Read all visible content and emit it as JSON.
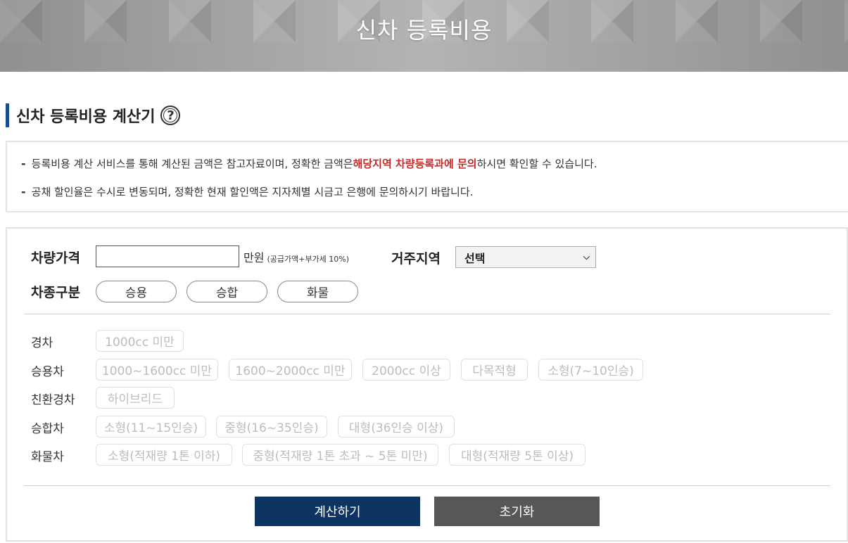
{
  "banner": {
    "title": "신차 등록비용"
  },
  "section": {
    "title": "신차 등록비용 계산기",
    "help_glyph": "?"
  },
  "notice": {
    "dash": "-",
    "line1_before": "등록비용 계산 서비스를 통해 계산된 금액은 참고자료이며, 정확한 금액은 ",
    "line1_highlight": "해당지역 차량등록과에 문의",
    "line1_after": "하시면 확인할 수 있습니다.",
    "line2": "공채 할인율은 수시로 변동되며, 정확한 현재 할인액은 지자체별 시금고 은행에 문의하시기 바랍니다.",
    "highlight_color": "#c62828"
  },
  "form": {
    "price_label": "차량가격",
    "price_value": "",
    "price_unit": "만원",
    "price_note": "(공급가액+부가세 10%)",
    "region_label": "거주지역",
    "region_selected": "선택",
    "type_label": "차종구분",
    "type_options": [
      "승용",
      "승합",
      "화물"
    ]
  },
  "categories": {
    "light": {
      "label": "경차",
      "options": [
        "1000cc 미만"
      ]
    },
    "passenger": {
      "label": "승용차",
      "options": [
        "1000~1600cc 미만",
        "1600~2000cc 미만",
        "2000cc 이상",
        "다목적형",
        "소형(7~10인승)"
      ]
    },
    "eco": {
      "label": "친환경차",
      "options": [
        "하이브리드"
      ]
    },
    "van": {
      "label": "승합차",
      "options": [
        "소형(11~15인승)",
        "중형(16~35인승)",
        "대형(36인승 이상)"
      ]
    },
    "truck": {
      "label": "화물차",
      "options": [
        "소형(적재량 1톤 이하)",
        "중형(적재량 1톤 초과 ~ 5톤 미만)",
        "대형(적재량 5톤 이상)"
      ]
    }
  },
  "actions": {
    "calculate": "계산하기",
    "reset": "초기화"
  },
  "colors": {
    "accent": "#1a4f8b",
    "primary_button": "#0e3461",
    "secondary_button": "#575757"
  }
}
